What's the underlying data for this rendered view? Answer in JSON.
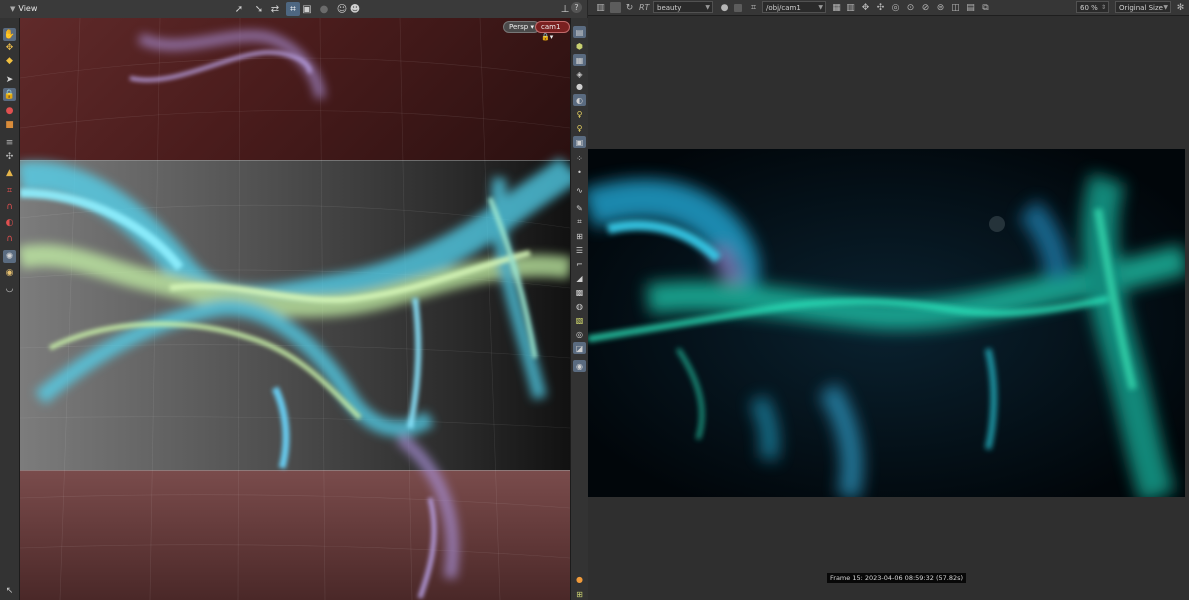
{
  "viewer": {
    "tab_label": "View",
    "persp_label": "Persp",
    "camera_label": "cam1",
    "help_glyph": "?"
  },
  "icons": {
    "viewer_toolbar": [
      "select-arrow-icon",
      "select-arrow-icon",
      "transform-handle-icon",
      "snapping-icon",
      "snap-grid-icon",
      "record-dot-icon",
      "eye-ghost-icon",
      "ghost-icon",
      "orientation-gizmo-icon"
    ],
    "left_tools": [
      "pointer-icon",
      "lock-icon",
      "red-sphere-icon",
      "orange-cube-icon",
      "stack-icon",
      "magnet-icon",
      "star-icon",
      "shield-icon",
      "gear-icon",
      "cursor-icon"
    ],
    "right_tools": [
      "shading-mode-icon",
      "cube-icon",
      "wireframe-icon",
      "light-icon",
      "lamp-icon",
      "camera-icon",
      "particle-icon",
      "curve-icon",
      "point-icon",
      "pencil-icon",
      "grid-icon",
      "measure-icon",
      "layers-icon",
      "paint-icon",
      "image-icon",
      "render-icon",
      "display-icon"
    ]
  },
  "render": {
    "rt_label": "RT",
    "aov": "beauty",
    "camera_path": "/obj/cam1",
    "zoom": "60 %",
    "size_mode": "Original Size",
    "frame_info": "Frame 15:  2023-04-06  08:59:32  (57.82s)"
  },
  "colors": {
    "viewport_top_band": "#5a2626",
    "viewport_bottom_band": "#6a3c3c",
    "points_cyan": "#52d6f2",
    "points_lime": "#c4f2a6",
    "points_lavender": "#a890d8",
    "render_teal": "#1bbfa5",
    "render_cyan": "#20a8d6",
    "selection_blue": "#4e6781",
    "camera_badge": "#7a2020"
  }
}
